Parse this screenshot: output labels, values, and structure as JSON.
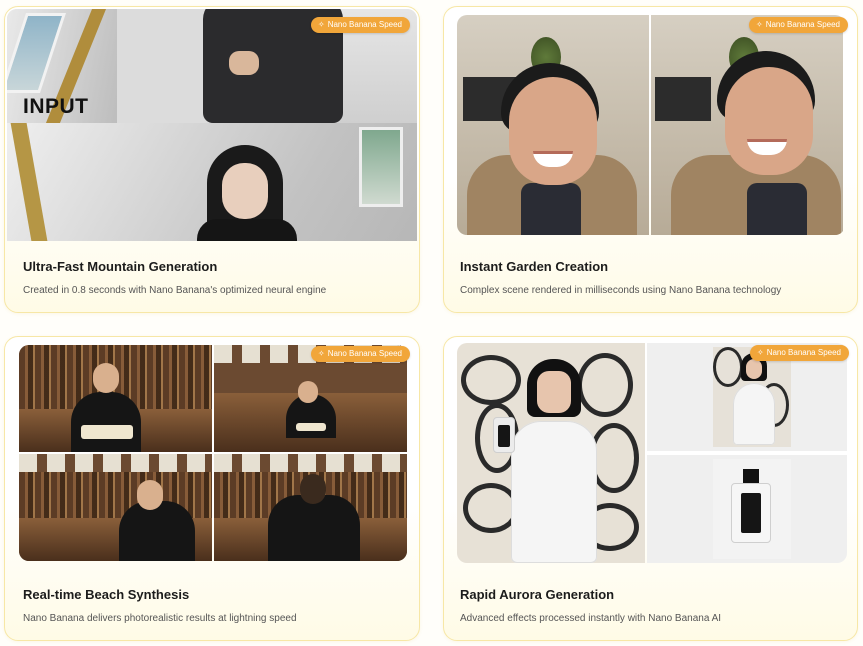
{
  "badge_label": "Nano Banana Speed",
  "badge_icon": "sparkle-icon",
  "accent_color": "#f1a63a",
  "cards": [
    {
      "overlay_text": "INPUT",
      "title": "Ultra-Fast Mountain Generation",
      "description": "Created in 0.8 seconds with Nano Banana's optimized neural engine"
    },
    {
      "title": "Instant Garden Creation",
      "description": "Complex scene rendered in milliseconds using Nano Banana technology"
    },
    {
      "title": "Real-time Beach Synthesis",
      "description": "Nano Banana delivers photorealistic results at lightning speed"
    },
    {
      "title": "Rapid Aurora Generation",
      "description": "Advanced effects processed instantly with Nano Banana AI"
    }
  ]
}
